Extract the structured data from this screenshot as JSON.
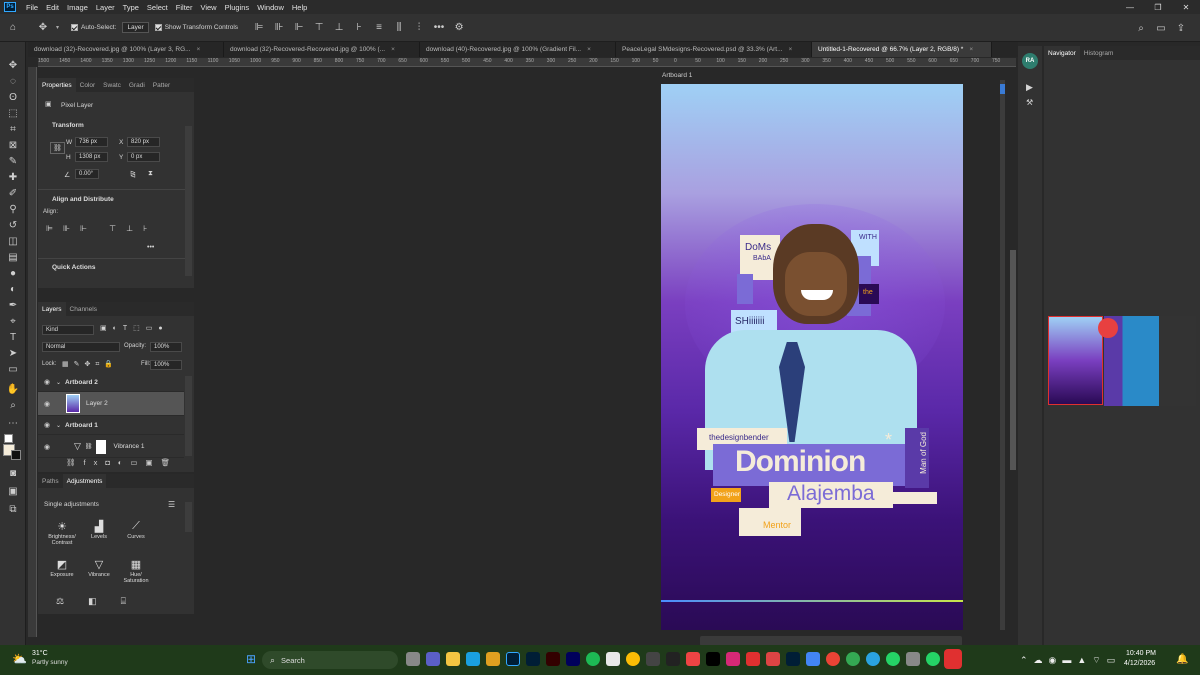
{
  "menu": {
    "items": [
      "File",
      "Edit",
      "Image",
      "Layer",
      "Type",
      "Select",
      "Filter",
      "View",
      "Plugins",
      "Window",
      "Help"
    ]
  },
  "options": {
    "auto_select": "Auto-Select:",
    "layer_select": "Layer",
    "show_transform": "Show Transform Controls",
    "more": "•••"
  },
  "tabs": [
    {
      "label": "download (32)-Recovered.jpg @ 100% (Layer 3, RG...",
      "close": "×"
    },
    {
      "label": "download (32)-Recovered-Recovered.jpg @ 100% (...",
      "close": "×"
    },
    {
      "label": "download (40)-Recovered.jpg @ 100% (Gradient Fil...",
      "close": "×"
    },
    {
      "label": "PeaceLegal SMdesigns-Recovered.psd @ 33.3% (Art...",
      "close": "×"
    },
    {
      "label": "Untitled-1-Recovered @ 66.7% (Layer 2, RGB/8) *",
      "close": "×"
    }
  ],
  "ruler": [
    "1500",
    "1450",
    "1400",
    "1350",
    "1300",
    "1250",
    "1200",
    "1150",
    "1100",
    "1050",
    "1000",
    "950",
    "900",
    "850",
    "800",
    "750",
    "700",
    "650",
    "600",
    "550",
    "500",
    "450",
    "400",
    "350",
    "300",
    "250",
    "200",
    "150",
    "100",
    "50",
    "0",
    "50",
    "100",
    "150",
    "200",
    "250",
    "300",
    "350",
    "400",
    "450",
    "500",
    "550",
    "600",
    "650",
    "700",
    "750"
  ],
  "properties": {
    "tabs": [
      "Properties",
      "Color",
      "Swatc",
      "Gradi",
      "Patter"
    ],
    "layer_type": "Pixel Layer",
    "transform": "Transform",
    "w_label": "W",
    "w": "736 px",
    "x_label": "X",
    "x": "820 px",
    "h_label": "H",
    "h": "1308 px",
    "y_label": "Y",
    "y": "0 px",
    "angle": "0.00°",
    "align": "Align and Distribute",
    "align_label": "Align:",
    "quick": "Quick Actions",
    "dots": "•••"
  },
  "layers": {
    "tabs": [
      "Layers",
      "Channels"
    ],
    "kind": "Kind",
    "blend": "Normal",
    "opacity_label": "Opacity:",
    "opacity": "100%",
    "lock": "Lock:",
    "fill_label": "Fill:",
    "fill": "100%",
    "rows": [
      "Artboard 2",
      "Layer 2",
      "Artboard 1",
      "Vibrance 1"
    ]
  },
  "adjustments": {
    "tabs": [
      "Paths",
      "Adjustments"
    ],
    "single": "Single adjustments",
    "items": [
      {
        "icon": "☀",
        "label": "Brightness/\nContrast"
      },
      {
        "icon": "▟",
        "label": "Levels"
      },
      {
        "icon": "⟋",
        "label": "Curves"
      },
      {
        "icon": "◩",
        "label": "Exposure"
      },
      {
        "icon": "▽",
        "label": "Vibrance"
      },
      {
        "icon": "▦",
        "label": "Hue/\nSaturation"
      }
    ]
  },
  "artboard": {
    "label": "Artboard 1",
    "doms": "DoMs",
    "baba": "BAbA",
    "with": "WITH",
    "the": "the",
    "shi": "SHiiiiiii",
    "designbender": "thedesignbender",
    "dominion": "Dominion",
    "man_of_god": "Man of God",
    "designer": "Designer",
    "alajemba": "Alajemba",
    "mentor": "Mentor",
    "star": "*"
  },
  "navigator": {
    "tabs": [
      "Navigator",
      "Histogram"
    ],
    "avatar": "RA"
  },
  "taskbar": {
    "temp": "31°C",
    "weather": "Partly sunny",
    "search": "Search",
    "time": "10:40 PM",
    "date": "4/12/2026"
  },
  "colors": {
    "accent": "#31a8ff",
    "purple_box": "#7b6bd6",
    "cream": "#f5ecd9",
    "orange": "#f2a21a"
  }
}
